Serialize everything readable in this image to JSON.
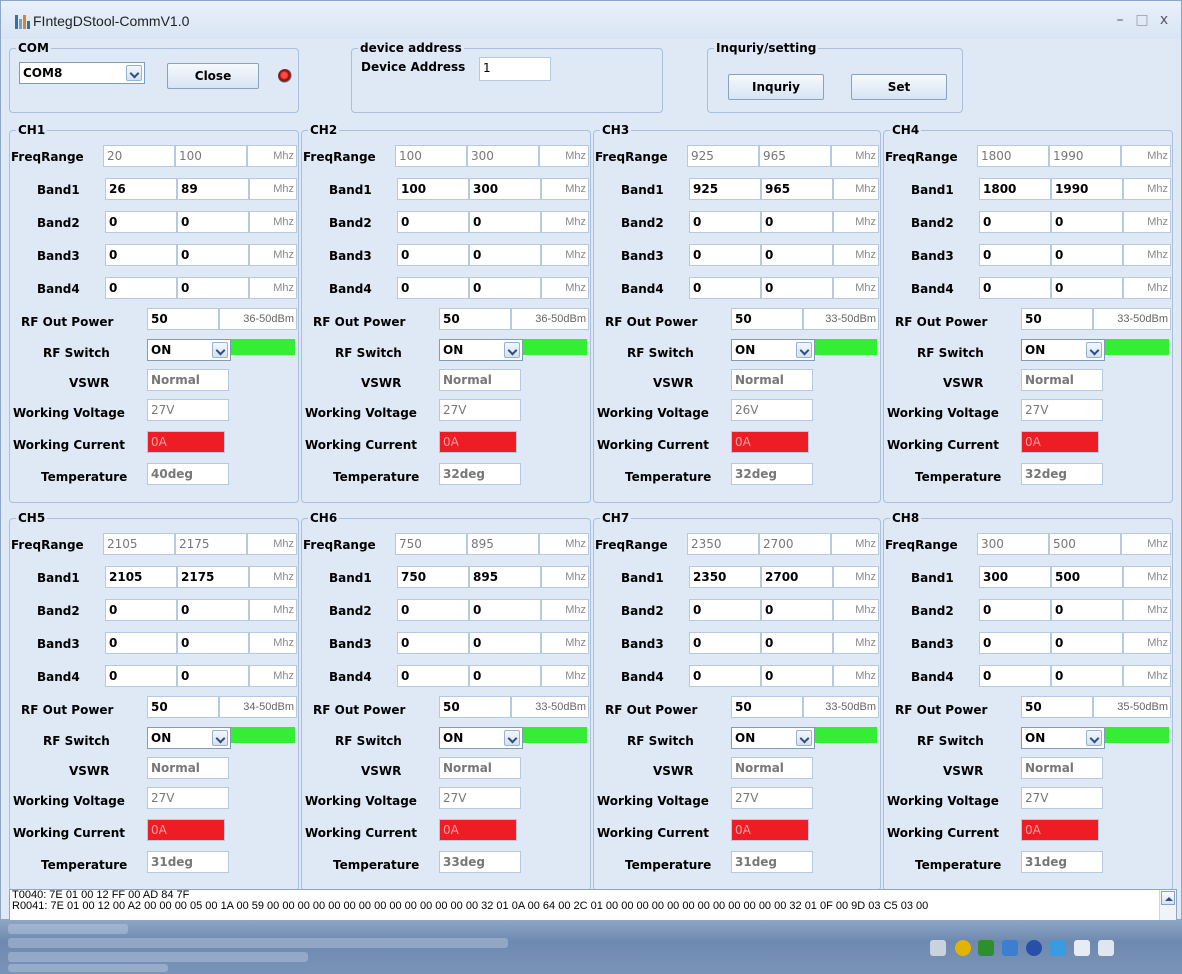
{
  "window": {
    "title": "FIntegDStool-CommV1.0",
    "minimize": "–",
    "maximize": "□",
    "close": "x"
  },
  "com": {
    "legend": "COM",
    "port": "COM8",
    "close_label": "Close"
  },
  "device": {
    "legend": "device address",
    "label": "Device Address",
    "value": "1"
  },
  "inquiry": {
    "legend": "Inquriy/setting",
    "inquiry_label": "Inquriy",
    "set_label": "Set"
  },
  "labels": {
    "freq_range": "FreqRange",
    "band1": "Band1",
    "band2": "Band2",
    "band3": "Band3",
    "band4": "Band4",
    "rf_out_power": "RF Out Power",
    "rf_switch": "RF Switch",
    "vswr": "VSWR",
    "working_voltage": "Working Voltage",
    "working_current": "Working Current",
    "temperature": "Temperature",
    "unit_mhz": "Mhz"
  },
  "colors": {
    "switch_on": "#33ee33",
    "current_alarm": "#ee1c24"
  },
  "channels": [
    {
      "name": "CH1",
      "freq": [
        "20",
        "100"
      ],
      "band1": [
        "26",
        "89"
      ],
      "band2": [
        "0",
        "0"
      ],
      "band3": [
        "0",
        "0"
      ],
      "band4": [
        "0",
        "0"
      ],
      "power": "50",
      "power_range": "36-50dBm",
      "switch": "ON",
      "vswr": "Normal",
      "voltage": "27V",
      "current": "0A",
      "temp": "40deg"
    },
    {
      "name": "CH2",
      "freq": [
        "100",
        "300"
      ],
      "band1": [
        "100",
        "300"
      ],
      "band2": [
        "0",
        "0"
      ],
      "band3": [
        "0",
        "0"
      ],
      "band4": [
        "0",
        "0"
      ],
      "power": "50",
      "power_range": "36-50dBm",
      "switch": "ON",
      "vswr": "Normal",
      "voltage": "27V",
      "current": "0A",
      "temp": "32deg"
    },
    {
      "name": "CH3",
      "freq": [
        "925",
        "965"
      ],
      "band1": [
        "925",
        "965"
      ],
      "band2": [
        "0",
        "0"
      ],
      "band3": [
        "0",
        "0"
      ],
      "band4": [
        "0",
        "0"
      ],
      "power": "50",
      "power_range": "33-50dBm",
      "switch": "ON",
      "vswr": "Normal",
      "voltage": "26V",
      "current": "0A",
      "temp": "32deg"
    },
    {
      "name": "CH4",
      "freq": [
        "1800",
        "1990"
      ],
      "band1": [
        "1800",
        "1990"
      ],
      "band2": [
        "0",
        "0"
      ],
      "band3": [
        "0",
        "0"
      ],
      "band4": [
        "0",
        "0"
      ],
      "power": "50",
      "power_range": "33-50dBm",
      "switch": "ON",
      "vswr": "Normal",
      "voltage": "27V",
      "current": "0A",
      "temp": "32deg"
    },
    {
      "name": "CH5",
      "freq": [
        "2105",
        "2175"
      ],
      "band1": [
        "2105",
        "2175"
      ],
      "band2": [
        "0",
        "0"
      ],
      "band3": [
        "0",
        "0"
      ],
      "band4": [
        "0",
        "0"
      ],
      "power": "50",
      "power_range": "34-50dBm",
      "switch": "ON",
      "vswr": "Normal",
      "voltage": "27V",
      "current": "0A",
      "temp": "31deg"
    },
    {
      "name": "CH6",
      "freq": [
        "750",
        "895"
      ],
      "band1": [
        "750",
        "895"
      ],
      "band2": [
        "0",
        "0"
      ],
      "band3": [
        "0",
        "0"
      ],
      "band4": [
        "0",
        "0"
      ],
      "power": "50",
      "power_range": "33-50dBm",
      "switch": "ON",
      "vswr": "Normal",
      "voltage": "27V",
      "current": "0A",
      "temp": "33deg"
    },
    {
      "name": "CH7",
      "freq": [
        "2350",
        "2700"
      ],
      "band1": [
        "2350",
        "2700"
      ],
      "band2": [
        "0",
        "0"
      ],
      "band3": [
        "0",
        "0"
      ],
      "band4": [
        "0",
        "0"
      ],
      "power": "50",
      "power_range": "33-50dBm",
      "switch": "ON",
      "vswr": "Normal",
      "voltage": "27V",
      "current": "0A",
      "temp": "31deg"
    },
    {
      "name": "CH8",
      "freq": [
        "300",
        "500"
      ],
      "band1": [
        "300",
        "500"
      ],
      "band2": [
        "0",
        "0"
      ],
      "band3": [
        "0",
        "0"
      ],
      "band4": [
        "0",
        "0"
      ],
      "power": "50",
      "power_range": "35-50dBm",
      "switch": "ON",
      "vswr": "Normal",
      "voltage": "27V",
      "current": "0A",
      "temp": "31deg"
    }
  ],
  "log": [
    "T0040: 7E 01 00 12 FF 00  AD 84 7F",
    "R0041: 7E 01 00 12 00 A2  00 00 00 05 00 1A 00 59 00 00 00 00 00 00 00 00 00 00 00 00 00 00 32 01 0A 00 64 00 2C 01 00 00 00 00 00 00 00 00 00 00 00 00 32 01 0F 00 9D 03 C5 03 00"
  ]
}
